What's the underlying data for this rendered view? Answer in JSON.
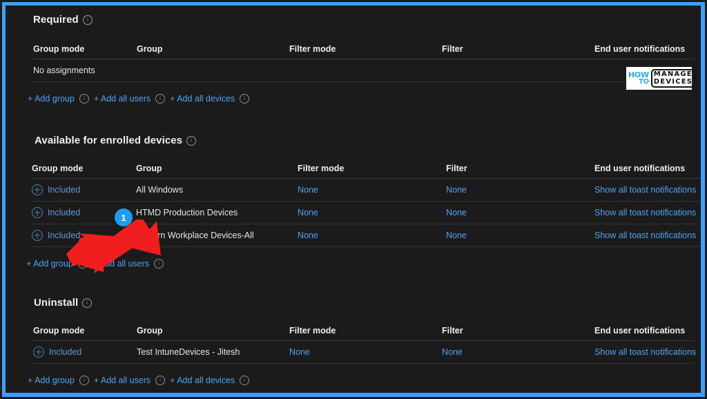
{
  "theme": {
    "accent_blue": "#3aa0ff",
    "link_blue": "#4ea3f2",
    "badge_blue": "#1f9cf0",
    "arrow_red": "#f01e1e",
    "panel_bg": "#1b1b1b"
  },
  "columns": [
    "Group mode",
    "Group",
    "Filter mode",
    "Filter",
    "End user notifications"
  ],
  "sections": [
    {
      "title": "Required",
      "empty_text": "No assignments",
      "rows": [],
      "links": [
        "+ Add group",
        "+ Add all users",
        "+ Add all devices"
      ]
    },
    {
      "title": "Available for enrolled devices",
      "empty_text": "",
      "rows": [
        {
          "group_mode": "Included",
          "group": "All Windows",
          "filter_mode": "None",
          "filter": "None",
          "end_user_notifications": "Show all toast notifications"
        },
        {
          "group_mode": "Included",
          "group": "HTMD Production Devices",
          "filter_mode": "None",
          "filter": "None",
          "end_user_notifications": "Show all toast notifications"
        },
        {
          "group_mode": "Included",
          "group": "Modern Workplace Devices-All",
          "filter_mode": "None",
          "filter": "None",
          "end_user_notifications": "Show all toast notifications"
        }
      ],
      "links": [
        "+ Add group",
        "+ Add all users"
      ]
    },
    {
      "title": "Uninstall",
      "empty_text": "",
      "rows": [
        {
          "group_mode": "Included",
          "group": "Test IntuneDevices - Jitesh",
          "filter_mode": "None",
          "filter": "None",
          "end_user_notifications": "Show all toast notifications"
        }
      ],
      "links": [
        "+ Add group",
        "+ Add all users",
        "+ Add all devices"
      ]
    }
  ],
  "annotations": {
    "badge_label": "1"
  },
  "watermark": {
    "how": "HOW",
    "to": "TO",
    "manage": "MANAGE",
    "devices": "DEVICES"
  }
}
